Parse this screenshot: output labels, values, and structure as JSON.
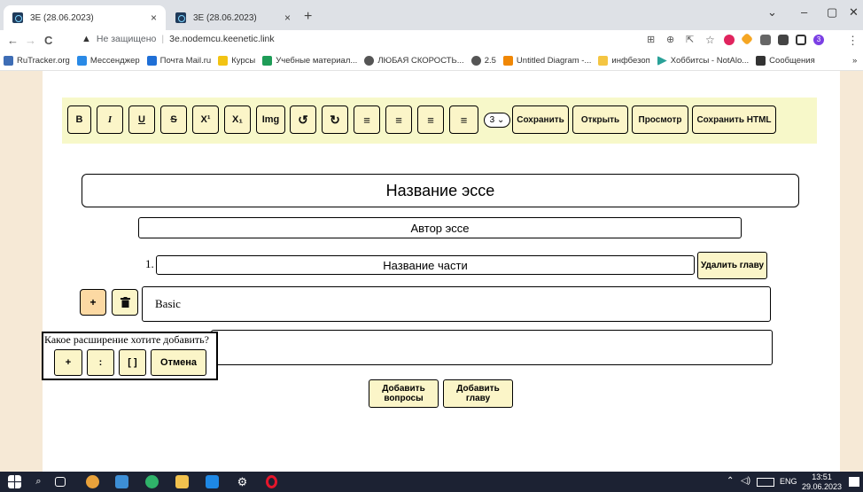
{
  "browser": {
    "tabs": [
      {
        "label": "3E (28.06.2023)",
        "active": true
      },
      {
        "label": "3E (28.06.2023)",
        "active": false
      }
    ],
    "new_tab": "+",
    "close_glyph": "×",
    "window_controls": {
      "chevron": "⌄",
      "minimize": "–",
      "maximize": "▢",
      "close": "✕"
    },
    "url": {
      "warning": "▲",
      "security": "Не защищено",
      "address": "3e.nodemcu.keenetic.link"
    },
    "nav": {
      "back": "←",
      "forward": "→",
      "reload": "C"
    },
    "right_icons": {
      "translate": "⊞",
      "zoom": "⊕",
      "share": "⇱",
      "star": "☆",
      "profile": "3",
      "menu": "⋮"
    },
    "bookmarks": [
      {
        "label": "RuTracker.org",
        "color": "#3e6db5"
      },
      {
        "label": "Мессенджер",
        "color": "#2a8ae6"
      },
      {
        "label": "Почта Mail.ru",
        "color": "#1f6fd6"
      },
      {
        "label": "Курсы",
        "color": "#f2c313"
      },
      {
        "label": "Учебные материал...",
        "color": "#1e9c57"
      },
      {
        "label": "ЛЮБАЯ СКОРОСТЬ...",
        "color": "#555555"
      },
      {
        "label": "2.5",
        "color": "#555555"
      },
      {
        "label": "Untitled Diagram -...",
        "color": "#f08705"
      },
      {
        "label": "инфбезоп",
        "color": "#f4c542"
      },
      {
        "label": "Хоббитсы - NotAlo...",
        "color": "#2aa198"
      },
      {
        "label": "Сообщения",
        "color": "#333333"
      }
    ],
    "bookmarks_more": "»"
  },
  "toolbar": {
    "bold": "B",
    "italic": "I",
    "underline": "U",
    "strike": "S",
    "superscript": "X¹",
    "subscript": "X₁",
    "img": "Img",
    "undo": "↺",
    "redo": "↻",
    "align_left": "≡",
    "align_center": "≡",
    "align_right": "≡",
    "justify": "≡",
    "heading_select": "3 ⌄",
    "save": "Сохранить",
    "open": "Открыть",
    "preview": "Просмотр",
    "save_html": "Сохранить HTML"
  },
  "essay": {
    "title": "Название эссе",
    "author": "Автор эссе",
    "part_number": "1.",
    "part_title": "Название части",
    "delete_chapter": "Удалить главу",
    "add_block": "+",
    "block_text": "Basic"
  },
  "popup": {
    "question": "Какое расширение хотите добавить?",
    "opt_plus": "+",
    "opt_colon": ":",
    "opt_brackets": "[ ]",
    "cancel": "Отмена"
  },
  "actions": {
    "add_questions": "Добавить вопросы",
    "add_chapter": "Добавить главу"
  },
  "taskbar": {
    "search": "⌕",
    "lang": "ENG",
    "time": "13:51",
    "date": "29.06.2023"
  },
  "colors": {
    "page_bg": "#f6e9d6",
    "toolbar_bg": "#f7f8c9",
    "button_bg": "#fbf5c8",
    "plus_bg": "#fcd9a3"
  }
}
